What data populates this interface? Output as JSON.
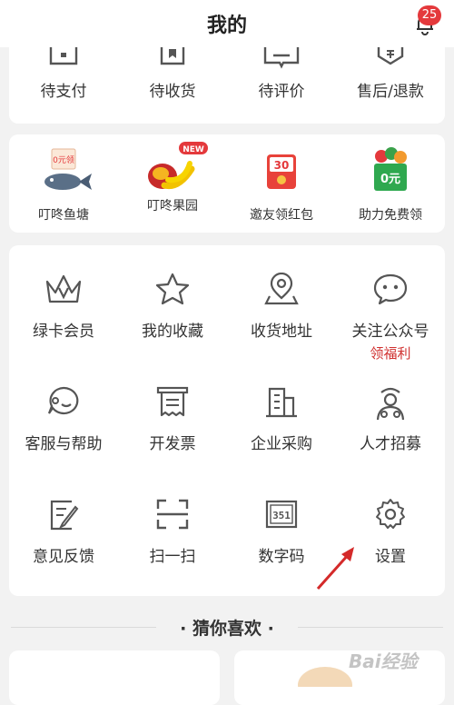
{
  "header": {
    "title": "我的",
    "badge_count": "25"
  },
  "orders": [
    {
      "label": "待支付",
      "icon": "wallet-icon"
    },
    {
      "label": "待收货",
      "icon": "package-icon"
    },
    {
      "label": "待评价",
      "icon": "comment-icon"
    },
    {
      "label": "售后/退款",
      "icon": "refund-icon"
    }
  ],
  "promos": [
    {
      "label": "叮咚鱼塘",
      "icon": "fish-pond-icon",
      "art_text": "0元领"
    },
    {
      "label": "叮咚果园",
      "icon": "fruit-orchard-icon",
      "tag": "NEW"
    },
    {
      "label": "邀友领红包",
      "icon": "red-envelope-icon",
      "art_text": "30"
    },
    {
      "label": "助力免费领",
      "icon": "free-gift-basket-icon",
      "art_text": "0元"
    }
  ],
  "services": [
    {
      "label": "绿卡会员",
      "icon": "crown-icon"
    },
    {
      "label": "我的收藏",
      "icon": "star-icon"
    },
    {
      "label": "收货地址",
      "icon": "location-pin-icon"
    },
    {
      "label": "关注公众号",
      "icon": "wechat-icon",
      "sub": "领福利"
    },
    {
      "label": "客服与帮助",
      "icon": "customer-service-icon"
    },
    {
      "label": "开发票",
      "icon": "invoice-icon"
    },
    {
      "label": "企业采购",
      "icon": "building-icon"
    },
    {
      "label": "人才招募",
      "icon": "recruit-icon"
    },
    {
      "label": "意见反馈",
      "icon": "feedback-icon"
    },
    {
      "label": "扫一扫",
      "icon": "scan-icon"
    },
    {
      "label": "数字码",
      "icon": "digit-code-icon",
      "icon_text": "351"
    },
    {
      "label": "设置",
      "icon": "gear-icon"
    }
  ],
  "recommend": {
    "title": "猜你喜欢"
  },
  "watermark": {
    "text": "Bai经验"
  },
  "colors": {
    "accent_red": "#e4393c",
    "link_red": "#d0302f",
    "icon_gray": "#555555"
  }
}
